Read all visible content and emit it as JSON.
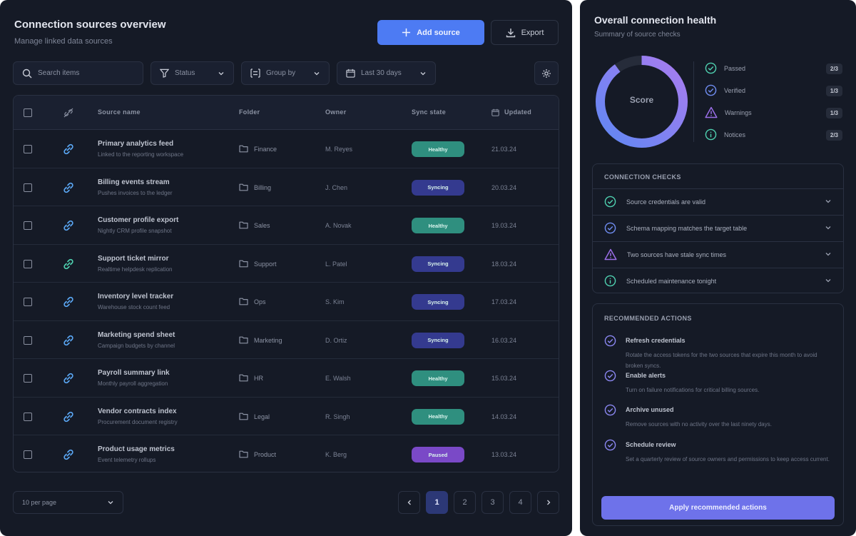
{
  "header": {
    "title": "Connection sources overview",
    "subtitle": "Manage linked data sources",
    "primary_label": "Add source",
    "secondary_label": "Export"
  },
  "toolbar": {
    "search_placeholder": "Search items",
    "filter_label": "Status",
    "group_label": "Group by",
    "date_label": "Last 30 days"
  },
  "table": {
    "columns": [
      "Source name",
      "Folder",
      "Owner",
      "Sync state",
      "Updated"
    ],
    "rows": [
      {
        "name": "Primary analytics feed",
        "desc": "Linked to the reporting workspace",
        "folder": "Finance",
        "owner": "M. Reyes",
        "status": "Healthy",
        "status_color": "#2f8f7f",
        "date": "21.03.24",
        "icon_color": "#5ba8f5"
      },
      {
        "name": "Billing events stream",
        "desc": "Pushes invoices to the ledger",
        "folder": "Billing",
        "owner": "J. Chen",
        "status": "Syncing",
        "status_color": "#343a8f",
        "date": "20.03.24",
        "icon_color": "#5ba8f5"
      },
      {
        "name": "Customer profile export",
        "desc": "Nightly CRM profile snapshot",
        "folder": "Sales",
        "owner": "A. Novak",
        "status": "Healthy",
        "status_color": "#2f8f7f",
        "date": "19.03.24",
        "icon_color": "#5ba8f5"
      },
      {
        "name": "Support ticket mirror",
        "desc": "Realtime helpdesk replication",
        "folder": "Support",
        "owner": "L. Patel",
        "status": "Syncing",
        "status_color": "#343a8f",
        "date": "18.03.24",
        "icon_color": "#4fd1b0"
      },
      {
        "name": "Inventory level tracker",
        "desc": "Warehouse stock count feed",
        "folder": "Ops",
        "owner": "S. Kim",
        "status": "Syncing",
        "status_color": "#343a8f",
        "date": "17.03.24",
        "icon_color": "#5ba8f5"
      },
      {
        "name": "Marketing spend sheet",
        "desc": "Campaign budgets by channel",
        "folder": "Marketing",
        "owner": "D. Ortiz",
        "status": "Syncing",
        "status_color": "#343a8f",
        "date": "16.03.24",
        "icon_color": "#5ba8f5"
      },
      {
        "name": "Payroll summary link",
        "desc": "Monthly payroll aggregation",
        "folder": "HR",
        "owner": "E. Walsh",
        "status": "Healthy",
        "status_color": "#2f8f7f",
        "date": "15.03.24",
        "icon_color": "#5ba8f5"
      },
      {
        "name": "Vendor contracts index",
        "desc": "Procurement document registry",
        "folder": "Legal",
        "owner": "R. Singh",
        "status": "Healthy",
        "status_color": "#2f8f7f",
        "date": "14.03.24",
        "icon_color": "#5ba8f5"
      },
      {
        "name": "Product usage metrics",
        "desc": "Event telemetry rollups",
        "folder": "Product",
        "owner": "K. Berg",
        "status": "Paused",
        "status_color": "#7a49c7",
        "date": "13.03.24",
        "icon_color": "#5ba8f5"
      }
    ]
  },
  "footer": {
    "page_size_label": "10 per page",
    "pages": [
      "1",
      "2",
      "3",
      "4"
    ]
  },
  "side": {
    "title": "Overall connection health",
    "subtitle": "Summary of source checks",
    "ring_label": "Score",
    "ring_value": 0.9,
    "legend": [
      {
        "label": "Passed",
        "count": "2/3",
        "color": "#4fd1b0",
        "icon": "check-circle-icon"
      },
      {
        "label": "Verified",
        "count": "1/3",
        "color": "#6f8cf0",
        "icon": "check-circle-icon"
      },
      {
        "label": "Warnings",
        "count": "1/3",
        "color": "#9b6ee8",
        "icon": "warning-icon"
      },
      {
        "label": "Notices",
        "count": "2/3",
        "color": "#4fd1b0",
        "icon": "info-icon"
      }
    ],
    "checks_title": "CONNECTION CHECKS",
    "checks": [
      {
        "label": "Source credentials are valid",
        "color": "#4fd1b0",
        "icon": "check-circle-icon"
      },
      {
        "label": "Schema mapping matches the target table",
        "color": "#6f8cf0",
        "icon": "check-circle-icon"
      },
      {
        "label": "Two sources have stale sync times",
        "color": "#9b6ee8",
        "icon": "warning-icon"
      },
      {
        "label": "Scheduled maintenance tonight",
        "color": "#4fd1b0",
        "icon": "info-icon"
      }
    ],
    "recs_title": "RECOMMENDED ACTIONS",
    "recs": [
      {
        "title": "Refresh credentials",
        "desc": "Rotate the access tokens for the two sources that expire this month to avoid broken syncs."
      },
      {
        "title": "Enable alerts",
        "desc": "Turn on failure notifications for critical billing sources."
      },
      {
        "title": "Archive unused",
        "desc": "Remove sources with no activity over the last ninety days."
      },
      {
        "title": "Schedule review",
        "desc": "Set a quarterly review of source owners and permissions to keep access current."
      }
    ],
    "apply_label": "Apply recommended actions"
  }
}
